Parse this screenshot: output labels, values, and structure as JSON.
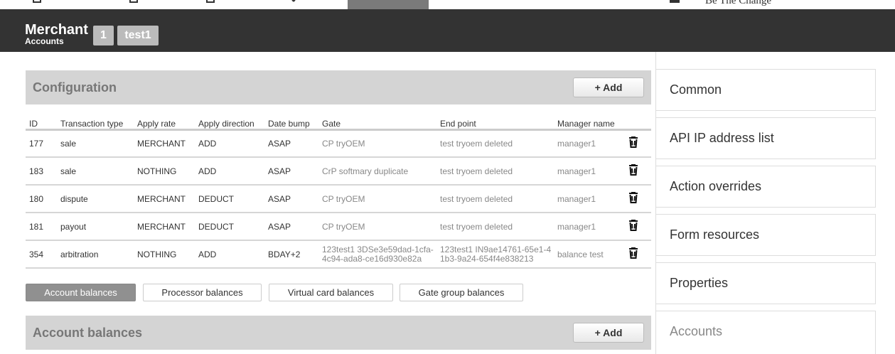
{
  "topnav": {
    "user_name": "Be The Change"
  },
  "header": {
    "title": "Merchant",
    "subtitle": "Accounts",
    "badge_count": "1",
    "badge_name": "test1"
  },
  "config": {
    "title": "Configuration",
    "add_label": "+ Add",
    "columns": [
      "ID",
      "Transaction type",
      "Apply rate",
      "Apply direction",
      "Date bump",
      "Gate",
      "End point",
      "Manager name"
    ],
    "rows": [
      {
        "id": "177",
        "type": "sale",
        "rate": "MERCHANT",
        "direction": "ADD",
        "bump": "ASAP",
        "gate": "CP tryOEM",
        "endpoint": "test tryoem deleted",
        "manager": "manager1"
      },
      {
        "id": "183",
        "type": "sale",
        "rate": "NOTHING",
        "direction": "ADD",
        "bump": "ASAP",
        "gate": "CrP softmary duplicate",
        "endpoint": "test tryoem deleted",
        "manager": "manager1"
      },
      {
        "id": "180",
        "type": "dispute",
        "rate": "MERCHANT",
        "direction": "DEDUCT",
        "bump": "ASAP",
        "gate": "CP tryOEM",
        "endpoint": "test tryoem deleted",
        "manager": "manager1"
      },
      {
        "id": "181",
        "type": "payout",
        "rate": "MERCHANT",
        "direction": "DEDUCT",
        "bump": "ASAP",
        "gate": "CP tryOEM",
        "endpoint": "test tryoem deleted",
        "manager": "manager1"
      },
      {
        "id": "354",
        "type": "arbitration",
        "rate": "NOTHING",
        "direction": "ADD",
        "bump": "BDAY+2",
        "gate": "123test1 3DSe3e59dad-1cfa-4c94-ada8-ce16d930e82a",
        "endpoint": "123test1 IN9ae14761-65e1-41b3-9a24-654f4e838213",
        "manager": "balance test"
      }
    ]
  },
  "tabs": [
    {
      "label": "Account balances",
      "active": true
    },
    {
      "label": "Processor balances",
      "active": false
    },
    {
      "label": "Virtual card balances",
      "active": false
    },
    {
      "label": "Gate group balances",
      "active": false
    }
  ],
  "balances": {
    "title": "Account balances",
    "add_label": "+ Add"
  },
  "sidebar": {
    "items": [
      {
        "label": "Common"
      },
      {
        "label": "API IP address list"
      },
      {
        "label": "Action overrides"
      },
      {
        "label": "Form resources"
      },
      {
        "label": "Properties"
      },
      {
        "label": "Accounts"
      }
    ]
  }
}
